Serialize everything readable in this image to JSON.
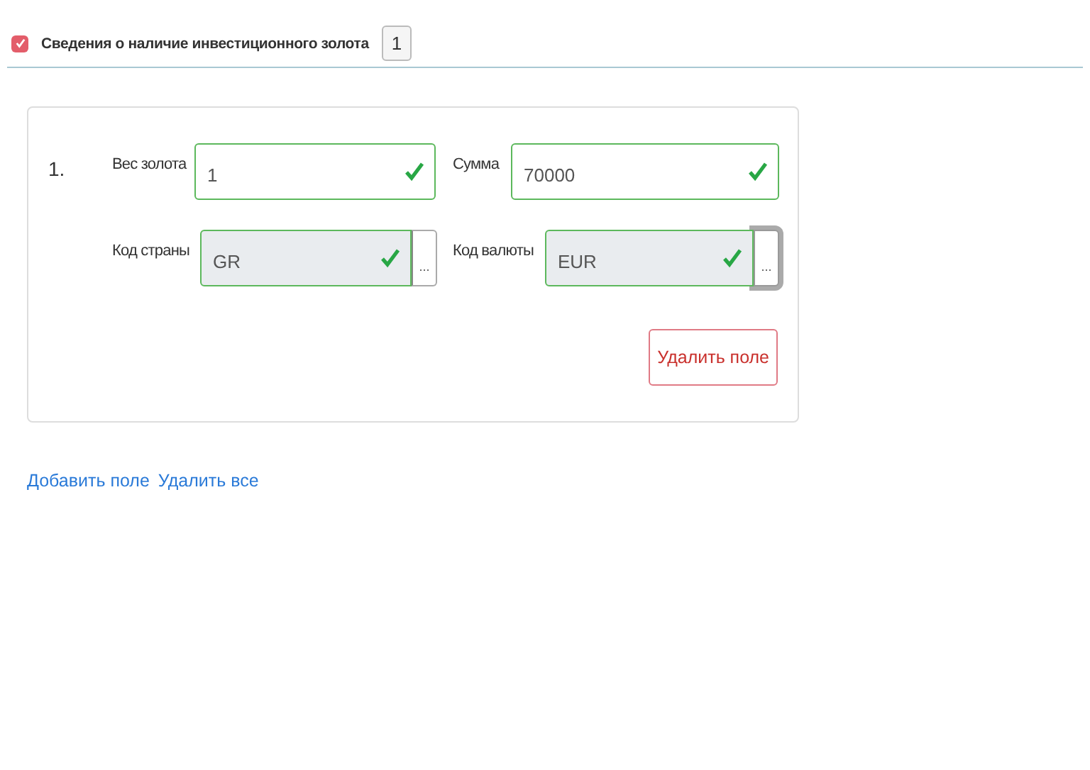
{
  "section": {
    "checked": true,
    "title": "Сведения о наличие инвестиционного золота",
    "count": "1"
  },
  "entries": [
    {
      "number": "1.",
      "rows": [
        [
          {
            "label": "Вес золота",
            "kind": "text",
            "value": "1",
            "valid": true,
            "readonly": false
          },
          {
            "label": "Сумма",
            "kind": "text",
            "value": "70000",
            "valid": true,
            "readonly": false
          }
        ],
        [
          {
            "label": "Код страны",
            "kind": "lookup",
            "value": "GR",
            "valid": true,
            "readonly": true,
            "button": "...",
            "focused": false
          },
          {
            "label": "Код валюты",
            "kind": "lookup",
            "value": "EUR",
            "valid": true,
            "readonly": true,
            "button": "...",
            "focused": true
          }
        ]
      ],
      "delete_button": "Удалить поле"
    }
  ],
  "links": [
    "Добавить поле",
    "Удалить все"
  ]
}
